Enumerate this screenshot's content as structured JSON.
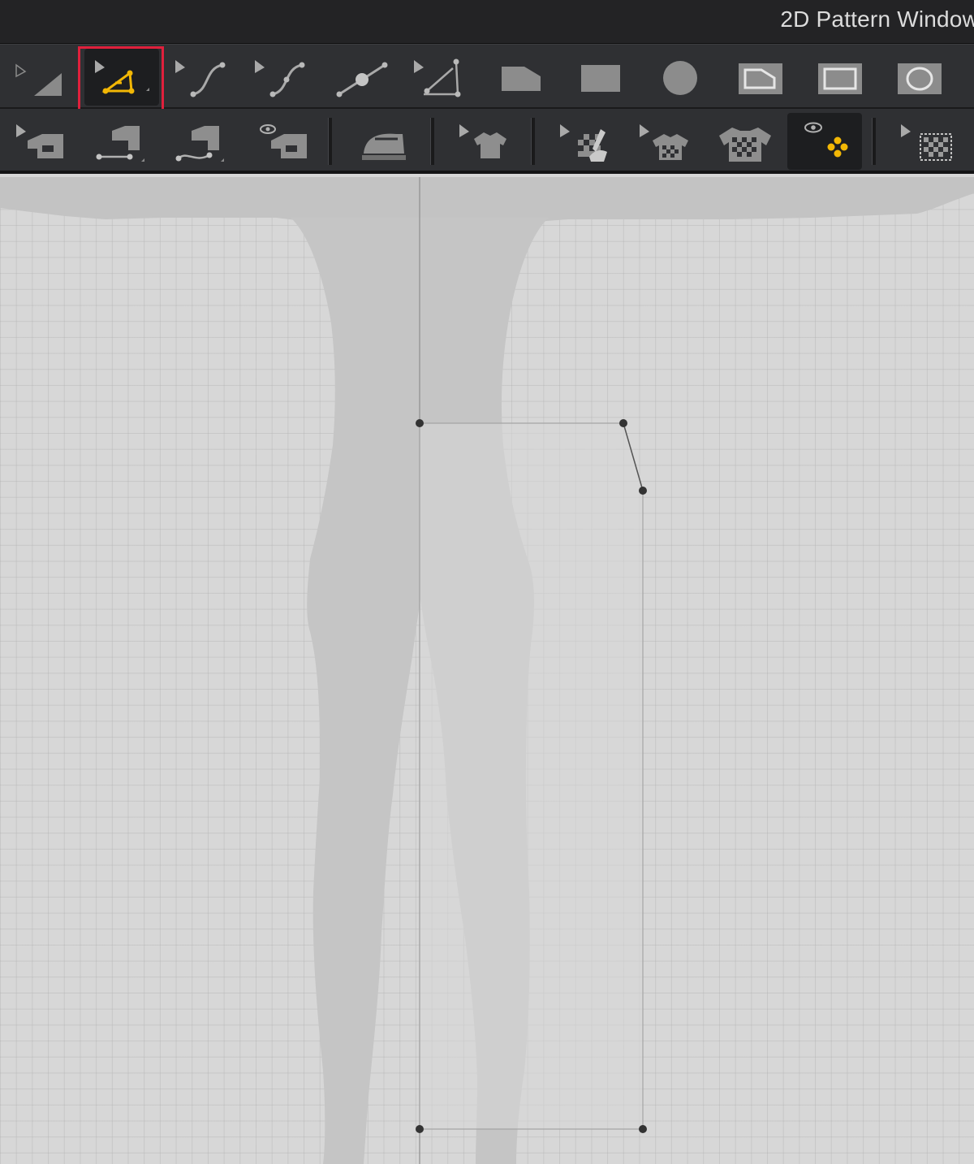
{
  "window": {
    "title": "2D Pattern Window"
  },
  "toolbar_top": {
    "tools": [
      {
        "name": "transform-pattern",
        "icon": "transform-pattern-icon",
        "active": false
      },
      {
        "name": "edit-point",
        "icon": "edit-point-icon",
        "active": true,
        "highlighted": true
      },
      {
        "name": "edit-curvature",
        "icon": "edit-curvature-icon",
        "active": false
      },
      {
        "name": "edit-curve-point",
        "icon": "curve-point-icon",
        "active": false
      },
      {
        "name": "add-point",
        "icon": "add-point-icon",
        "active": false
      },
      {
        "name": "internal-line",
        "icon": "internal-line-icon",
        "active": false
      },
      {
        "name": "polygon",
        "icon": "polygon-icon",
        "active": false
      },
      {
        "name": "rectangle",
        "icon": "rectangle-icon",
        "active": false
      },
      {
        "name": "circle",
        "icon": "circle-icon",
        "active": false
      },
      {
        "name": "internal-polygon",
        "icon": "internal-polygon-icon",
        "active": false
      },
      {
        "name": "internal-rectangle",
        "icon": "internal-rectangle-icon",
        "active": false
      },
      {
        "name": "internal-circle",
        "icon": "internal-circle-icon",
        "active": false
      }
    ]
  },
  "toolbar_bottom": {
    "tools": [
      {
        "name": "edit-sewing",
        "icon": "edit-sewing-icon",
        "active": false
      },
      {
        "name": "segment-sewing",
        "icon": "segment-sewing-icon",
        "active": false
      },
      {
        "name": "free-sewing",
        "icon": "free-sewing-icon",
        "active": false
      },
      {
        "name": "check-sewing",
        "icon": "check-sewing-icon",
        "active": false
      },
      {
        "name": "fold-ironing",
        "icon": "iron-icon",
        "active": false
      },
      {
        "name": "edit-garment",
        "icon": "shirt-icon",
        "active": false
      },
      {
        "name": "edit-texture",
        "icon": "texture-edit-icon",
        "active": false
      },
      {
        "name": "edit-fabric",
        "icon": "fabric-shirt-icon",
        "active": false
      },
      {
        "name": "fabric-shirt",
        "icon": "checker-shirt-icon",
        "active": false
      },
      {
        "name": "show-points",
        "icon": "show-points-icon",
        "active": true
      },
      {
        "name": "select-texture",
        "icon": "texture-select-icon",
        "active": false
      }
    ]
  },
  "colors": {
    "accent": "#f2b705",
    "highlight": "#e0203c",
    "toolbar_bg": "#2f3033",
    "canvas_bg": "#d7d7d7"
  }
}
